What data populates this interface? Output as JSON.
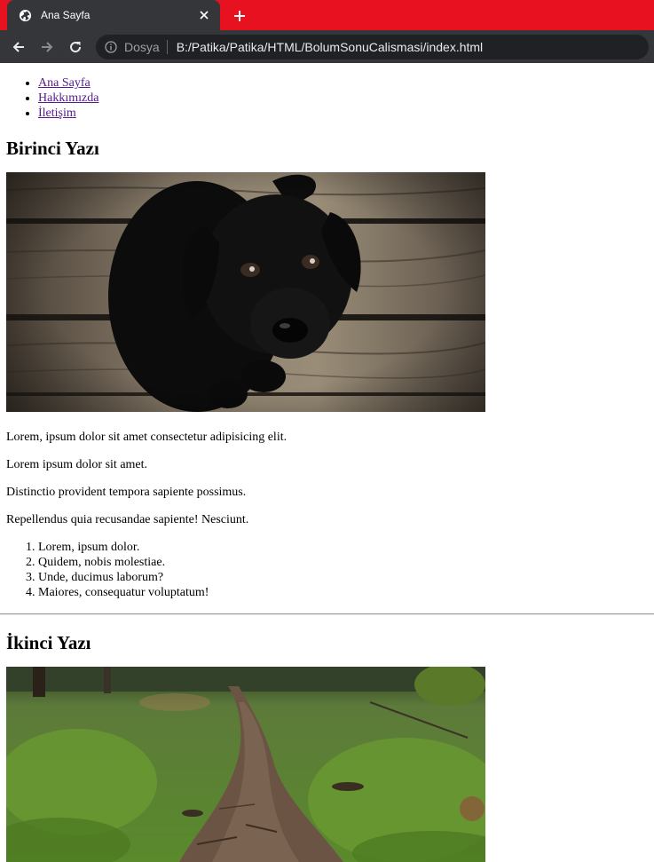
{
  "browser": {
    "tab_title": "Ana Sayfa",
    "scheme_label": "Dosya",
    "url": "B:/Patika/Patika/HTML/BolumSonuCalismasi/index.html",
    "tabbar_color": "#e8111f",
    "toolbar_color": "#35363a"
  },
  "nav": {
    "items": [
      {
        "label": "Ana Sayfa"
      },
      {
        "label": "Hakkımızda"
      },
      {
        "label": "İletişim"
      }
    ]
  },
  "posts": [
    {
      "title": "Birinci Yazı",
      "image": "black-puppy-on-wooden-floor",
      "paragraphs": [
        "Lorem, ipsum dolor sit amet consectetur adipisicing elit.",
        "Lorem ipsum dolor sit amet.",
        "Distinctio provident tempora sapiente possimus.",
        "Repellendus quia recusandae sapiente! Nesciunt."
      ],
      "list": [
        "Lorem, ipsum dolor.",
        "Quidem, nobis molestiae.",
        "Unde, ducimus laborum?",
        "Maiores, consequatur voluptatum!"
      ]
    },
    {
      "title": "İkinci Yazı",
      "image": "mossy-forest-path"
    }
  ]
}
